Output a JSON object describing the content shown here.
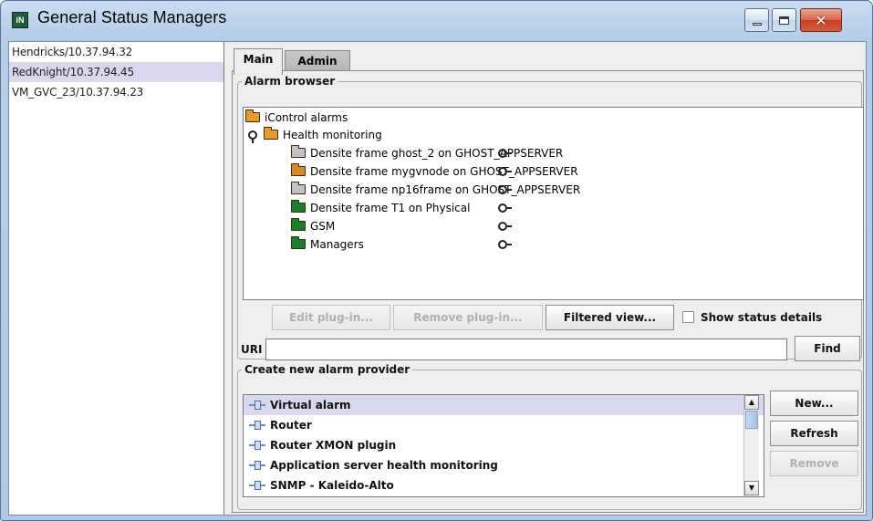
{
  "window": {
    "title": "General Status Managers",
    "icon_text": "iN",
    "close_glyph": "✕"
  },
  "servers": [
    "Hendricks/10.37.94.32",
    "RedKnight/10.37.94.45",
    "VM_GVC_23/10.37.94.23"
  ],
  "selected_server": "RedKnight/10.37.94.45",
  "tabs": [
    "Main",
    "Admin"
  ],
  "active_tab": "Main",
  "alarm_browser": {
    "legend": "Alarm browser",
    "tree": [
      {
        "label": "iControl alarms",
        "icon": "folder-open-icon",
        "level": 0
      },
      {
        "label": "Health monitoring",
        "icon": "folder-open-icon",
        "level": 1,
        "expanded": true
      },
      {
        "label": "Densite frame ghost_2 on GHOST_APPSERVER",
        "icon": "folder-gray-icon",
        "level": 2
      },
      {
        "label": "Densite frame mygvnode on GHOST_APPSERVER",
        "icon": "folder-orange-icon",
        "level": 2
      },
      {
        "label": "Densite frame np16frame on GHOST_APPSERVER",
        "icon": "folder-gray-icon",
        "level": 2
      },
      {
        "label": "Densite frame T1 on Physical",
        "icon": "folder-green-icon",
        "level": 2
      },
      {
        "label": "GSM",
        "icon": "folder-green-icon",
        "level": 2
      },
      {
        "label": "Managers",
        "icon": "folder-green-icon",
        "level": 2
      }
    ],
    "buttons": {
      "edit_plugin": "Edit plug-in...",
      "remove_plugin": "Remove plug-in...",
      "filtered_view": "Filtered view..."
    },
    "show_status_details_label": "Show status details",
    "show_status_details_checked": false,
    "uri_label": "URI",
    "uri_value": "",
    "find_label": "Find"
  },
  "create_provider": {
    "legend": "Create new alarm provider",
    "items": [
      "Virtual alarm",
      "Router",
      "Router XMON plugin",
      "Application server health monitoring",
      "SNMP - Kaleido-Alto"
    ],
    "selected": "Virtual alarm",
    "buttons": {
      "new": "New...",
      "refresh": "Refresh",
      "remove": "Remove"
    }
  },
  "colors": {
    "selection": "#d8d8ef",
    "panel_bg": "#eeeeee",
    "title_bar": "#b6cde8",
    "close_button": "#c6401f"
  }
}
